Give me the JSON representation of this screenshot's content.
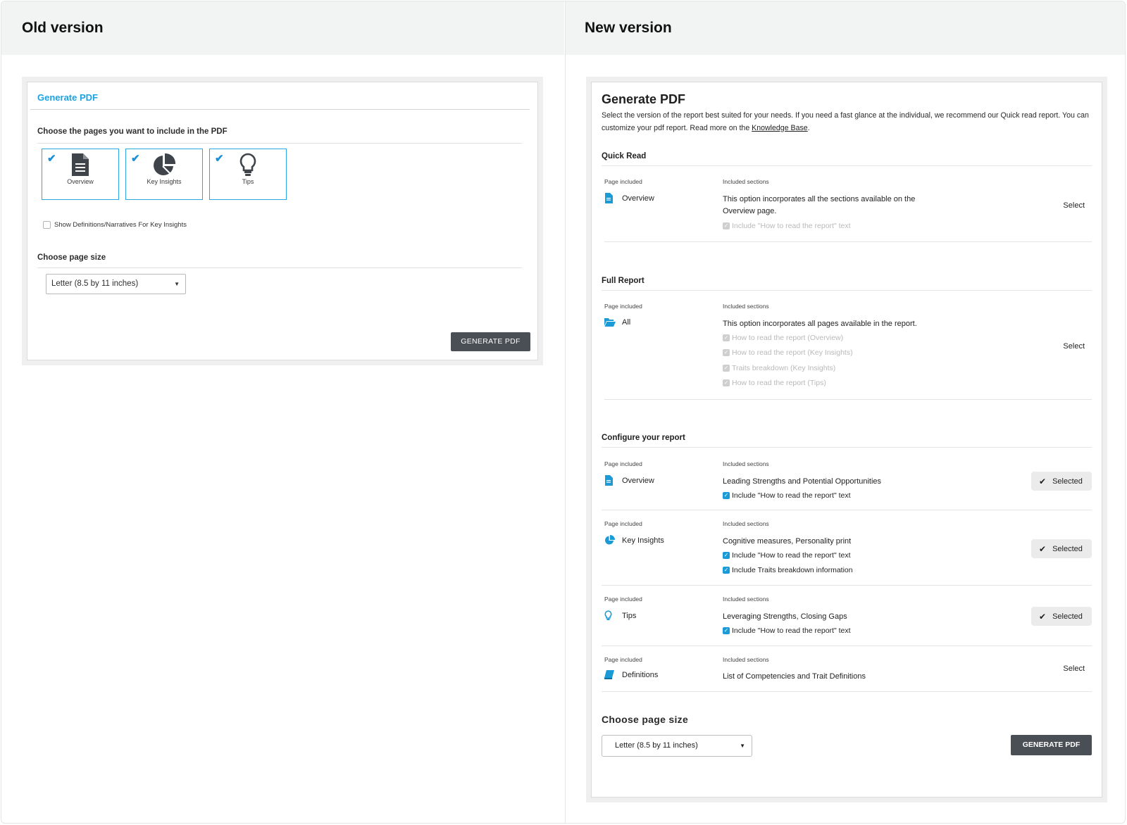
{
  "old": {
    "header": "Old version",
    "title": "Generate PDF",
    "choose_pages_label": "Choose the pages you want to include in the PDF",
    "pages": [
      {
        "label": "Overview",
        "checked": true,
        "icon": "document-icon"
      },
      {
        "label": "Key Insights",
        "checked": true,
        "icon": "pie-chart-icon"
      },
      {
        "label": "Tips",
        "checked": true,
        "icon": "lightbulb-icon"
      }
    ],
    "definitions_option": "Show Definitions/Narratives For Key Insights",
    "page_size_label": "Choose page size",
    "page_size_value": "Letter (8.5 by 11 inches)",
    "generate_label": "GENERATE PDF"
  },
  "new": {
    "header": "New version",
    "title": "Generate PDF",
    "intro_text": "Select the version of the report best suited for your needs. If you need a fast glance at the individual, we recommend our Quick read report. You can customize your pdf report. Read more on the ",
    "intro_link": "Knowledge Base",
    "intro_end": ".",
    "col_page": "Page included",
    "col_sections": "Included sections",
    "select_label": "Select",
    "selected_label": "Selected",
    "quick_read": {
      "heading": "Quick Read",
      "page": "Overview",
      "text_line1": "This option incorporates all the sections available on the",
      "text_line2": "Overview page.",
      "options": [
        "Include \"How to read the report\" text"
      ]
    },
    "full_report": {
      "heading": "Full Report",
      "page": "All",
      "text": "This option incorporates all pages available in the report.",
      "options": [
        "How to read the report (Overview)",
        "How to read the report (Key Insights)",
        "Traits breakdown (Key Insights)",
        "How to read the report (Tips)"
      ]
    },
    "configure": {
      "heading": "Configure your report",
      "rows": [
        {
          "page": "Overview",
          "text": "Leading Strengths and Potential Opportunities",
          "options": [
            "Include \"How to read the report\" text"
          ],
          "status": "Selected"
        },
        {
          "page": "Key Insights",
          "text": "Cognitive measures, Personality print",
          "options": [
            "Include \"How to read the report\" text",
            "Include Traits breakdown information"
          ],
          "status": "Selected"
        },
        {
          "page": "Tips",
          "text": "Leveraging Strengths, Closing Gaps",
          "options": [
            "Include \"How to read the report\" text"
          ],
          "status": "Selected"
        },
        {
          "page": "Definitions",
          "text": "List of Competencies and Trait Definitions",
          "options": [],
          "status": "Select"
        }
      ]
    },
    "page_size_label": "Choose page size",
    "page_size_value": "Letter (8.5 by 11 inches)",
    "generate_label": "GENERATE PDF"
  },
  "colors": {
    "accent": "#1a9ad6",
    "old_title": "#1aa3e0",
    "button_dark": "#4a4f55",
    "panel_bg": "#efefef",
    "header_bg": "#f2f3f3"
  }
}
